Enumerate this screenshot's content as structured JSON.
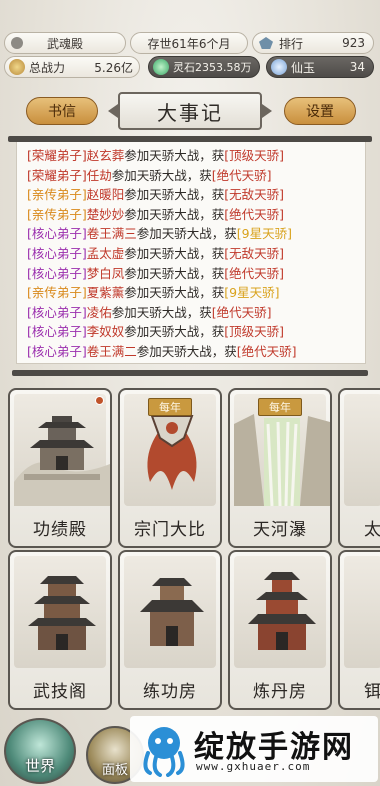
{
  "status": {
    "sect_name": "武魂殿",
    "era": "存世61年6个月",
    "rank_label": "排行",
    "rank_value": "923",
    "power_label": "总战力",
    "power_value": "5.26亿",
    "spirit_stone": "灵石2353.58万",
    "jade_label": "仙玉",
    "jade_value": "34"
  },
  "header": {
    "left_tab": "书信",
    "title": "大事记",
    "right_tab": "设置"
  },
  "log_lines": [
    {
      "rank": "[荣耀弟子]",
      "name": "赵玄葬",
      "mid": "参加天骄大战，获",
      "award": "[顶级天骄]",
      "rank_color": "#c0392b",
      "award_color": "#c0392b"
    },
    {
      "rank": "[荣耀弟子]",
      "name": "任劫",
      "mid": "参加天骄大战，获",
      "award": "[绝代天骄]",
      "rank_color": "#c0392b",
      "award_color": "#c0392b"
    },
    {
      "rank": "[亲传弟子]",
      "name": "赵暖阳",
      "mid": "参加天骄大战，获",
      "award": "[无敌天骄]",
      "rank_color": "#d98a1c",
      "award_color": "#c0392b"
    },
    {
      "rank": "[亲传弟子]",
      "name": "楚妙妙",
      "mid": "参加天骄大战，获",
      "award": "[绝代天骄]",
      "rank_color": "#d98a1c",
      "award_color": "#c0392b"
    },
    {
      "rank": "[核心弟子]",
      "name": "卷王满三",
      "mid": "参加天骄大战，获",
      "award": "[9星天骄]",
      "rank_color": "#9b2fae",
      "award_color": "#d9a21c"
    },
    {
      "rank": "[核心弟子]",
      "name": "孟太虚",
      "mid": "参加天骄大战，获",
      "award": "[无敌天骄]",
      "rank_color": "#9b2fae",
      "award_color": "#c0392b"
    },
    {
      "rank": "[核心弟子]",
      "name": "梦白凤",
      "mid": "参加天骄大战，获",
      "award": "[绝代天骄]",
      "rank_color": "#9b2fae",
      "award_color": "#c0392b"
    },
    {
      "rank": "[亲传弟子]",
      "name": "夏紫薰",
      "mid": "参加天骄大战，获",
      "award": "[9星天骄]",
      "rank_color": "#d98a1c",
      "award_color": "#d9a21c"
    },
    {
      "rank": "[核心弟子]",
      "name": "凌佑",
      "mid": "参加天骄大战，获",
      "award": "[绝代天骄]",
      "rank_color": "#9b2fae",
      "award_color": "#c0392b"
    },
    {
      "rank": "[核心弟子]",
      "name": "李奴奴",
      "mid": "参加天骄大战，获",
      "award": "[顶级天骄]",
      "rank_color": "#9b2fae",
      "award_color": "#c0392b"
    },
    {
      "rank": "[核心弟子]",
      "name": "卷王满二",
      "mid": "参加天骄大战，获",
      "award": "[绝代天骄]",
      "rank_color": "#9b2fae",
      "award_color": "#c0392b"
    }
  ],
  "buildings_row1": [
    {
      "label": "功绩殿",
      "badge": ""
    },
    {
      "label": "宗门大比",
      "badge": "每年"
    },
    {
      "label": "天河瀑",
      "badge": "每年"
    },
    {
      "label": "太",
      "badge": ""
    }
  ],
  "buildings_row2": [
    {
      "label": "武技阁"
    },
    {
      "label": "练功房"
    },
    {
      "label": "炼丹房"
    },
    {
      "label": "铒"
    }
  ],
  "bottom_nav": {
    "world": "世界",
    "panel": "面板"
  },
  "watermark": {
    "title": "绽放手游网",
    "url": "www.gxhuaer.com"
  },
  "colors": {
    "name_color": "#c0392b",
    "accent_gold": "#c9993f",
    "dark_line": "#4d4a46"
  }
}
